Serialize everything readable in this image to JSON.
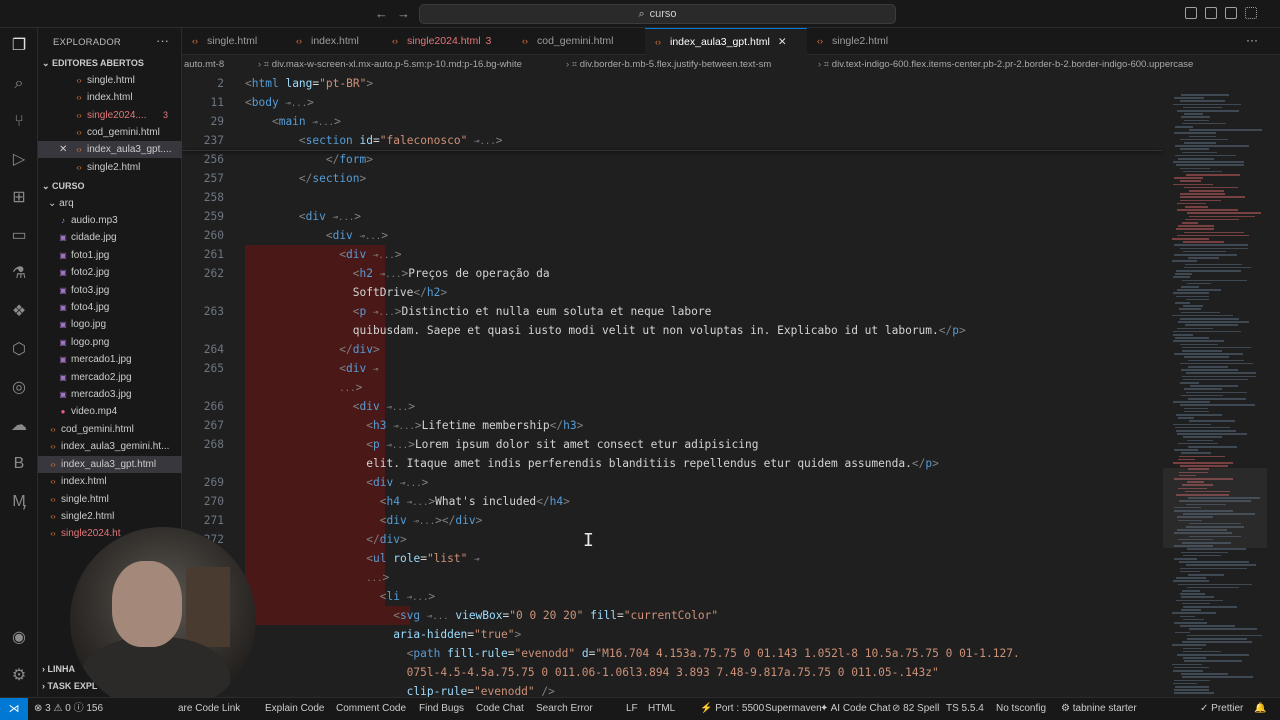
{
  "titlebar": {
    "search": "curso",
    "back": "←",
    "forward": "→"
  },
  "sidebar": {
    "explorer_title": "EXPLORADOR",
    "open_editors_title": "EDITORES ABERTOS",
    "open_editors": [
      {
        "name": "single.html",
        "modified": false,
        "badge": ""
      },
      {
        "name": "index.html",
        "modified": false,
        "badge": ""
      },
      {
        "name": "single2024....",
        "modified": true,
        "badge": "3"
      },
      {
        "name": "cod_gemini.html",
        "modified": false,
        "badge": ""
      },
      {
        "name": "index_aula3_gpt....",
        "modified": false,
        "badge": "",
        "selected": true
      },
      {
        "name": "single2.html",
        "modified": false,
        "badge": ""
      }
    ],
    "folder_title": "CURSO",
    "arq_folder": "arq",
    "arq_files": [
      "audio.mp3",
      "cidade.jpg",
      "foto1.jpg",
      "foto2.jpg",
      "foto3.jpg",
      "foto4.jpg",
      "logo.jpg",
      "logo.png",
      "mercado1.jpg",
      "mercado2.jpg",
      "mercado3.jpg",
      "video.mp4"
    ],
    "root_files": [
      {
        "name": "cod_gemini.html",
        "selected": false,
        "modified": false
      },
      {
        "name": "index_aula3_gemini.ht...",
        "selected": false,
        "modified": false
      },
      {
        "name": "index_aula3_gpt.html",
        "selected": true,
        "modified": false
      },
      {
        "name": "index.html",
        "selected": false,
        "modified": false
      },
      {
        "name": "single.html",
        "selected": false,
        "modified": false
      },
      {
        "name": "single2.html",
        "selected": false,
        "modified": false
      },
      {
        "name": "single2024.ht",
        "selected": false,
        "modified": true
      }
    ],
    "outline": "LINHA",
    "timeline": "TASK EXPL"
  },
  "tabs": [
    {
      "label": "single.html",
      "active": false,
      "modified": false,
      "badge": ""
    },
    {
      "label": "index.html",
      "active": false,
      "modified": false,
      "badge": ""
    },
    {
      "label": "single2024.html",
      "active": false,
      "modified": true,
      "badge": "3"
    },
    {
      "label": "cod_gemini.html",
      "active": false,
      "modified": false,
      "badge": ""
    },
    {
      "label": "index_aula3_gpt.html",
      "active": true,
      "modified": false,
      "badge": ""
    },
    {
      "label": "single2.html",
      "active": false,
      "modified": false,
      "badge": ""
    }
  ],
  "breadcrumb": [
    "auto.mt-8",
    "div.max-w-screen-xl.mx-auto.p-5.sm:p-10.md:p-16.bg-white",
    "div.border-b.mb-5.flex.justify-between.text-sm",
    "div.text-indigo-600.flex.items-center.pb-2.pr-2.border-b-2.border-indigo-600.uppercase"
  ],
  "status": {
    "problems": "⊗ 3 ⚠ 0 ⓘ 156",
    "items": [
      "are Code Link",
      "Explain Code",
      "Comment Code",
      "Find Bugs",
      "Code Chat",
      "Search Error",
      "LF",
      "HTML",
      "⚡ Port : 5500",
      "Supermaven",
      "✦ AI Code Chat",
      "⊘ 82 Spell",
      "TS 5.5.4",
      "No tsconfig",
      "⚙ tabnine starter",
      "✓ Prettier"
    ]
  },
  "icons": {
    "explorer": "files-icon",
    "search": "search-icon",
    "scm": "source-control-icon",
    "run": "run-debug-icon",
    "extensions": "extensions-icon",
    "remote": "remote-explorer-icon",
    "testing": "testing-icon",
    "python": "python-icon",
    "account": "account-icon",
    "settings": "gear-icon"
  }
}
